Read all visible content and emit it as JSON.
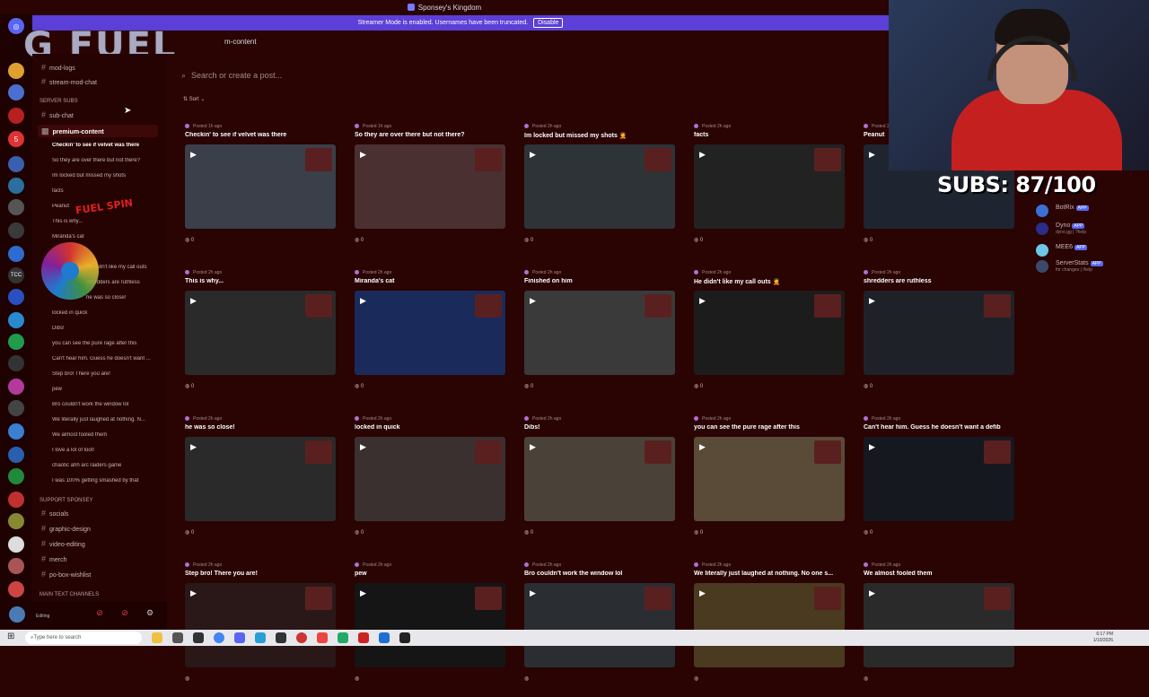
{
  "window": {
    "title": "Sponsey's Kingdom"
  },
  "banner": {
    "text": "Streamer Mode is enabled. Usernames have been truncated.",
    "button": "Disable"
  },
  "overlay": {
    "brand": "G FUEL",
    "subs_label": "SUBS: 87/100",
    "spin_text": "FUEL SPIN"
  },
  "channel": {
    "title": "m-content"
  },
  "sidebar": {
    "items": [
      {
        "label": "mod-logs"
      },
      {
        "label": "stream-mod-chat"
      }
    ],
    "category_server_subs": "SERVER SUBS",
    "sub_chat": "sub-chat",
    "premium": "premium-content",
    "threads": [
      "Checkin' to see if velvet was there",
      "So they are over there but not there?",
      "Im locked but missed my shots",
      "facts",
      "Peanut",
      "This is why...",
      "Miranda's cat",
      "He didn't like my call outs",
      "shredders are ruthless",
      "he was so close!",
      "locked in quick",
      "Dibs!",
      "you can see the pure rage after this",
      "Can't hear him. Guess he doesn't want ...",
      "Step bro! There you are!",
      "pew",
      "Bro couldn't work the window lol",
      "We literally just laughed at nothing. N...",
      "We almost fooled them",
      "I love a lot of loot!",
      "chaotic ahh arc raiders game",
      "I was 100% getting smashed by that"
    ],
    "category_support": "SUPPORT SPONSEY",
    "support_items": [
      "socials",
      "graphic-design",
      "video-editing",
      "merch",
      "po-box-wishlist"
    ],
    "category_main": "MAIN TEXT CHANNELS"
  },
  "user": {
    "status": "Editing"
  },
  "main": {
    "search_placeholder": "Search or create a post...",
    "sort_label": "Sort",
    "posts": [
      {
        "meta": "Posted 1h ago",
        "title": "Checkin' to see if velvet was there",
        "count": "0"
      },
      {
        "meta": "Posted 1h ago",
        "title": "So they are over there but not there?",
        "count": "0"
      },
      {
        "meta": "Posted 2h ago",
        "title": "Im locked but missed my shots 🤦",
        "count": "0"
      },
      {
        "meta": "Posted 2h ago",
        "title": "facts",
        "count": "0"
      },
      {
        "meta": "Posted 2h ago",
        "title": "Peanut",
        "count": "0"
      },
      {
        "meta": "Posted 2h ago",
        "title": "This is why...",
        "count": "0"
      },
      {
        "meta": "Posted 2h ago",
        "title": "Miranda's cat",
        "count": "0"
      },
      {
        "meta": "Posted 2h ago",
        "title": "Finished on him",
        "count": "0"
      },
      {
        "meta": "Posted 2h ago",
        "title": "He didn't like my call outs 🤦",
        "count": "0"
      },
      {
        "meta": "Posted 2h ago",
        "title": "shredders are ruthless",
        "count": "0"
      },
      {
        "meta": "Posted 2h ago",
        "title": "he was so close!",
        "count": "0"
      },
      {
        "meta": "Posted 2h ago",
        "title": "locked in quick",
        "count": "0"
      },
      {
        "meta": "Posted 2h ago",
        "title": "Dibs!",
        "count": "0"
      },
      {
        "meta": "Posted 2h ago",
        "title": "you can see the pure rage after this",
        "count": "0"
      },
      {
        "meta": "Posted 2h ago",
        "title": "Can't hear him. Guess he doesn't want a defib",
        "count": "0"
      },
      {
        "meta": "Posted 2h ago",
        "title": "Step bro! There you are!",
        "count": ""
      },
      {
        "meta": "Posted 2h ago",
        "title": "pew",
        "count": ""
      },
      {
        "meta": "Posted 2h ago",
        "title": "Bro couldn't work the window lol",
        "count": ""
      },
      {
        "meta": "Posted 2h ago",
        "title": "We literally just laughed at nothing. No one s...",
        "count": ""
      },
      {
        "meta": "Posted 2h ago",
        "title": "We almost fooled them",
        "count": ""
      }
    ]
  },
  "members": [
    {
      "name": "BotRix",
      "badge": "APP",
      "sub": "",
      "color": "#3a6fd6"
    },
    {
      "name": "Dyno",
      "badge": "APP",
      "sub": "dyno.gg | ?help",
      "color": "#2c2c8a"
    },
    {
      "name": "MEE6",
      "badge": "APP",
      "sub": "",
      "color": "#6fc6e8"
    },
    {
      "name": "ServerStats",
      "badge": "APP",
      "sub": "for changes | /help",
      "color": "#3b4a6b"
    }
  ],
  "taskbar": {
    "search_placeholder": "Type here to search",
    "time": "6:17 PM",
    "date": "1/10/2026"
  },
  "colors": {
    "background": "#2a0303",
    "banner": "#5b3fd6",
    "accent_purple": "#b06fd6"
  }
}
